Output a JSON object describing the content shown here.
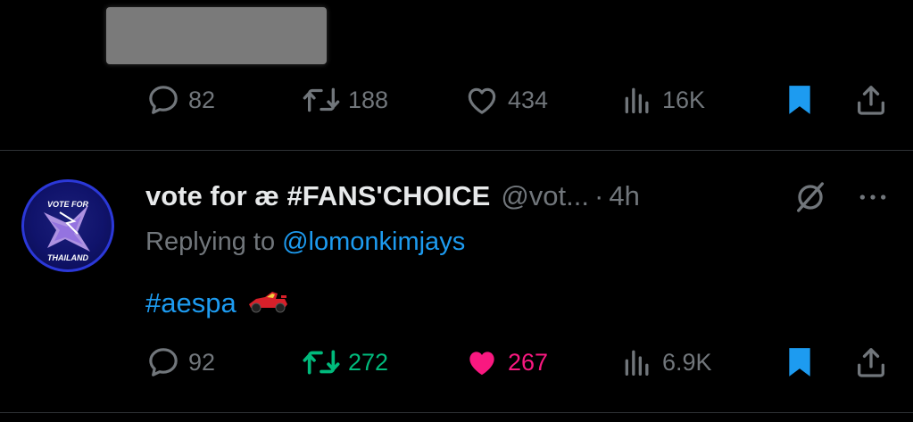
{
  "prev_tweet": {
    "actions": {
      "replies": "82",
      "reposts": "188",
      "likes": "434",
      "views": "16K"
    }
  },
  "tweet": {
    "avatar": {
      "line1": "VOTE FOR",
      "line2": "THAILAND"
    },
    "display_name": "vote for æ #FANS'CHOICE",
    "handle": "@vot...",
    "separator": "·",
    "time": "4h",
    "replying_prefix": "Replying to",
    "replying_to": "@lomonkimjays",
    "hashtag": "#aespa",
    "actions": {
      "replies": "92",
      "reposts": "272",
      "likes": "267",
      "views": "6.9K"
    }
  },
  "colors": {
    "background": "#000000",
    "text": "#e7e9ea",
    "muted": "#71767b",
    "link": "#1d9bf0",
    "repost_active": "#00ba7c",
    "like_active": "#f91880",
    "bookmark_active": "#1d9bf0"
  },
  "icons": [
    "reply-icon",
    "repost-icon",
    "like-icon",
    "views-icon",
    "bookmark-icon",
    "share-icon",
    "grok-icon",
    "more-icon",
    "racecar-emoji"
  ]
}
